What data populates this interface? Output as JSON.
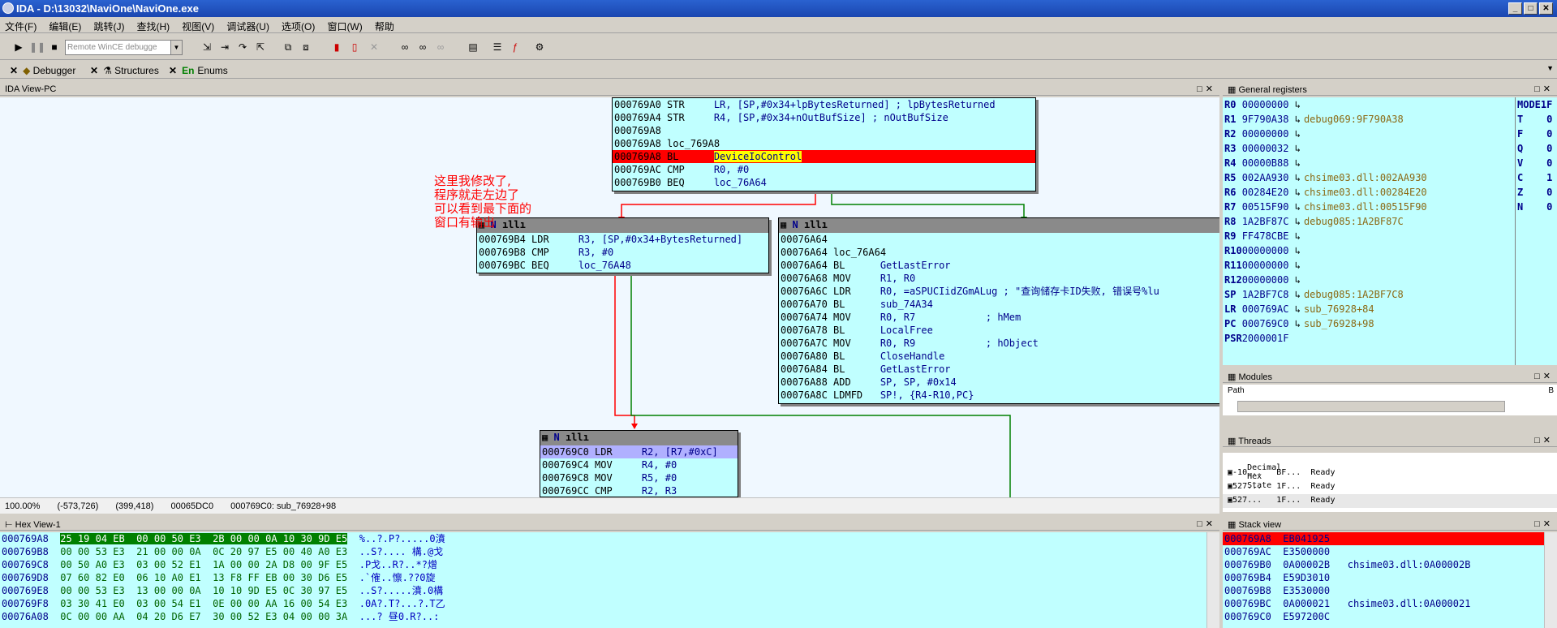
{
  "window": {
    "title": "IDA - D:\\13032\\NaviOne\\NaviOne.exe"
  },
  "menu": [
    "文件(F)",
    "编辑(E)",
    "跳转(J)",
    "查找(H)",
    "视图(V)",
    "调试器(U)",
    "选项(O)",
    "窗口(W)",
    "帮助"
  ],
  "toolbar": {
    "debugger_combo": "Remote WinCE debugge"
  },
  "tabs": [
    {
      "label": "Debugger"
    },
    {
      "label": "Structures"
    },
    {
      "label": "Enums",
      "prefix": "En"
    }
  ],
  "ida_view": {
    "title": "IDA View-PC"
  },
  "annotation": [
    "这里我修改了,",
    "程序就走左边了",
    "可以看到最下面的",
    "窗口有输出"
  ],
  "nodes": {
    "top": [
      {
        "addr": "000769A0",
        "mn": "STR",
        "op": "LR, [SP,#0x34+lpBytesReturned] ; lpBytesReturned"
      },
      {
        "addr": "000769A4",
        "mn": "STR",
        "op": "R4, [SP,#0x34+nOutBufSize] ; nOutBufSize"
      },
      {
        "addr": "000769A8",
        "mn": "",
        "op": ""
      },
      {
        "addr": "000769A8",
        "mn": "loc_769A8",
        "op": ""
      },
      {
        "addr": "000769A8",
        "mn": "BL",
        "op": "DeviceIoControl"
      },
      {
        "addr": "000769AC",
        "mn": "CMP",
        "op": "R0, #0"
      },
      {
        "addr": "000769B0",
        "mn": "BEQ",
        "op": "loc_76A64"
      }
    ],
    "left": [
      {
        "addr": "000769B4",
        "mn": "LDR",
        "op": "R3, [SP,#0x34+BytesReturned]"
      },
      {
        "addr": "000769B8",
        "mn": "CMP",
        "op": "R3, #0"
      },
      {
        "addr": "000769BC",
        "mn": "BEQ",
        "op": "loc_76A48"
      }
    ],
    "right": [
      {
        "addr": "00076A64",
        "mn": "",
        "op": ""
      },
      {
        "addr": "00076A64",
        "mn": "loc_76A64",
        "op": ""
      },
      {
        "addr": "00076A64",
        "mn": "BL",
        "op": "GetLastError"
      },
      {
        "addr": "00076A68",
        "mn": "MOV",
        "op": "R1, R0"
      },
      {
        "addr": "00076A6C",
        "mn": "LDR",
        "op": "R0, =aSPUCIidZGmALug ; \"查询储存卡ID失败, 错误号%lu"
      },
      {
        "addr": "00076A70",
        "mn": "BL",
        "op": "sub_74A34"
      },
      {
        "addr": "00076A74",
        "mn": "MOV",
        "op": "R0, R7            ; hMem"
      },
      {
        "addr": "00076A78",
        "mn": "BL",
        "op": "LocalFree"
      },
      {
        "addr": "00076A7C",
        "mn": "MOV",
        "op": "R0, R9            ; hObject"
      },
      {
        "addr": "00076A80",
        "mn": "BL",
        "op": "CloseHandle"
      },
      {
        "addr": "00076A84",
        "mn": "BL",
        "op": "GetLastError"
      },
      {
        "addr": "00076A88",
        "mn": "ADD",
        "op": "SP, SP, #0x14"
      },
      {
        "addr": "00076A8C",
        "mn": "LDMFD",
        "op": "SP!, {R4-R10,PC}"
      }
    ],
    "bottom": [
      {
        "addr": "000769C0",
        "mn": "LDR",
        "op": "R2, [R7,#0xC]"
      },
      {
        "addr": "000769C4",
        "mn": "MOV",
        "op": "R4, #0"
      },
      {
        "addr": "000769C8",
        "mn": "MOV",
        "op": "R5, #0"
      },
      {
        "addr": "000769CC",
        "mn": "CMP",
        "op": "R2, R3"
      }
    ]
  },
  "status": {
    "zoom": "100.00%",
    "coords": "(-573,726)",
    "pos": "(399,418)",
    "offset": "00065DC0",
    "location": "000769C0: sub_76928+98"
  },
  "hex": {
    "title": "Hex View-1",
    "rows": [
      {
        "a": "000769A8",
        "h": "25 19 04 EB  00 00 50 E3  2B 00 00 0A 10 30 9D E5",
        "t": "%..?.P?.....0濆"
      },
      {
        "a": "000769B8",
        "h": "00 00 53 E3  21 00 00 0A  0C 20 97 E5 00 40 A0 E3",
        "t": "..S?.... 構.@戈"
      },
      {
        "a": "000769C8",
        "h": "00 50 A0 E3  03 00 52 E1  1A 00 00 2A D8 00 9F E5",
        "t": ".P戈..R?..*?熷"
      },
      {
        "a": "000769D8",
        "h": "07 60 82 E0  06 10 A0 E1  13 F8 FF EB 00 30 D6 E5",
        "t": ".`傕..懔.??0旋"
      },
      {
        "a": "000769E8",
        "h": "00 00 53 E3  13 00 00 0A  10 10 9D E5 0C 30 97 E5",
        "t": "..S?.....濆.0構"
      },
      {
        "a": "000769F8",
        "h": "03 30 41 E0  03 00 54 E1  0E 00 00 AA 16 00 54 E3",
        "t": ".0A?.T?...?.T乙"
      },
      {
        "a": "00076A08",
        "h": "0C 00 00 AA  04 20 D6 E7  30 00 52 E3 04 00 00 3A",
        "t": "...? 昼0.R?..:"
      }
    ]
  },
  "registers": {
    "title": "General registers",
    "rows": [
      {
        "n": "R0",
        "v": "00000000",
        "c": ""
      },
      {
        "n": "R1",
        "v": "9F790A38",
        "c": "debug069:9F790A38"
      },
      {
        "n": "R2",
        "v": "00000000",
        "c": ""
      },
      {
        "n": "R3",
        "v": "00000032",
        "c": ""
      },
      {
        "n": "R4",
        "v": "00000B88",
        "c": ""
      },
      {
        "n": "R5",
        "v": "002AA930",
        "c": "chsime03.dll:002AA930"
      },
      {
        "n": "R6",
        "v": "00284E20",
        "c": "chsime03.dll:00284E20"
      },
      {
        "n": "R7",
        "v": "00515F90",
        "c": "chsime03.dll:00515F90"
      },
      {
        "n": "R8",
        "v": "1A2BF87C",
        "c": "debug085:1A2BF87C"
      },
      {
        "n": "R9",
        "v": "FF478CBE",
        "c": ""
      },
      {
        "n": "R10",
        "v": "00000000",
        "c": ""
      },
      {
        "n": "R11",
        "v": "00000000",
        "c": ""
      },
      {
        "n": "R12",
        "v": "00000000",
        "c": ""
      },
      {
        "n": "SP",
        "v": "1A2BF7C8",
        "c": "debug085:1A2BF7C8"
      },
      {
        "n": "LR",
        "v": "000769AC",
        "c": "sub_76928+84"
      },
      {
        "n": "PC",
        "v": "000769C0",
        "c": "sub_76928+98"
      },
      {
        "n": "PSR",
        "v": "2000001F",
        "c": ""
      }
    ],
    "flags": [
      {
        "n": "MODE",
        "v": "1F"
      },
      {
        "n": "T",
        "v": "0"
      },
      {
        "n": "F",
        "v": "0"
      },
      {
        "n": "Q",
        "v": "0"
      },
      {
        "n": "V",
        "v": "0"
      },
      {
        "n": "C",
        "v": "1"
      },
      {
        "n": "Z",
        "v": "0"
      },
      {
        "n": "N",
        "v": "0"
      }
    ]
  },
  "modules": {
    "title": "Modules",
    "col_path": "Path",
    "col_base": "B"
  },
  "threads": {
    "title": "Threads",
    "cols": [
      "Decimal",
      "Hex",
      "State"
    ],
    "rows": [
      {
        "d": "-10...",
        "h": "BF...",
        "s": "Ready"
      },
      {
        "d": "527...",
        "h": "1F...",
        "s": "Ready"
      },
      {
        "d": "527...",
        "h": "1F...",
        "s": "Ready"
      }
    ]
  },
  "stack": {
    "title": "Stack view",
    "rows": [
      {
        "a": "000769A8",
        "v": "EB041925",
        "c": ""
      },
      {
        "a": "000769AC",
        "v": "E3500000",
        "c": ""
      },
      {
        "a": "000769B0",
        "v": "0A00002B",
        "c": "chsime03.dll:0A00002B"
      },
      {
        "a": "000769B4",
        "v": "E59D3010",
        "c": ""
      },
      {
        "a": "000769B8",
        "v": "E3530000",
        "c": ""
      },
      {
        "a": "000769BC",
        "v": "0A000021",
        "c": "chsime03.dll:0A000021"
      },
      {
        "a": "000769C0",
        "v": "E597200C",
        "c": ""
      }
    ]
  },
  "colors": {
    "node_bg": "#c0ffff",
    "highlight": "#ff0000",
    "graph_bg": "#f0f8ff",
    "edge_true": "#008000",
    "edge_false": "#ff0000"
  }
}
